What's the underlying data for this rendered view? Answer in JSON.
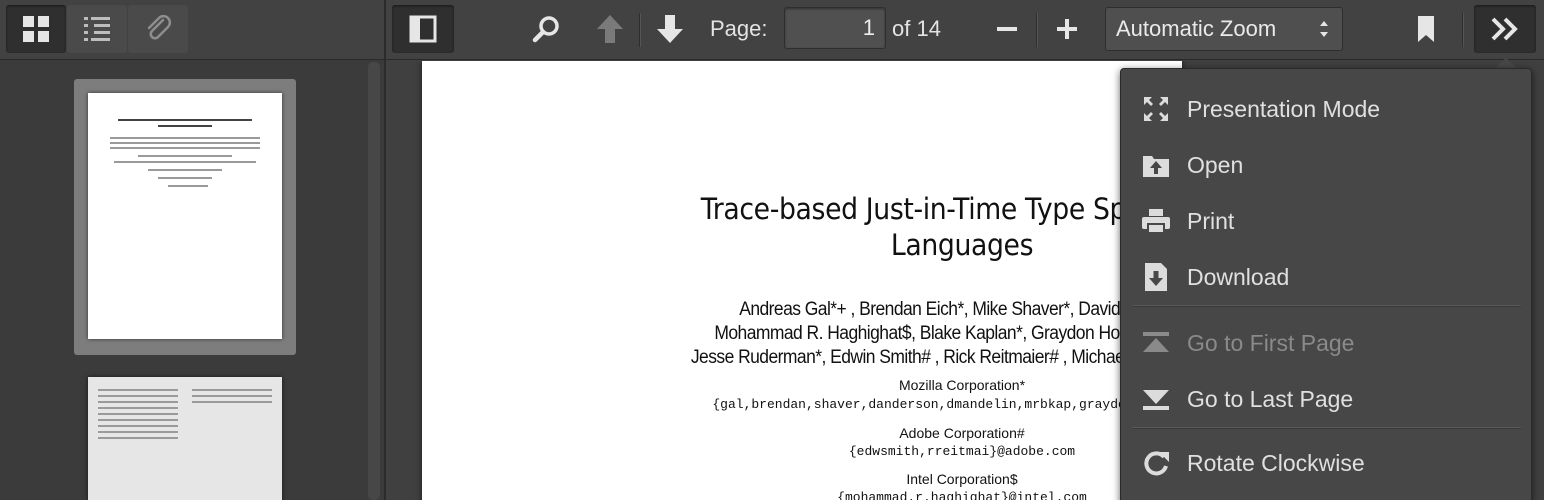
{
  "sidebar": {
    "buttons": [
      {
        "name": "thumbnail-view",
        "icon": "grid-icon"
      },
      {
        "name": "outline-view",
        "icon": "list-icon"
      },
      {
        "name": "attachments-view",
        "icon": "paperclip-icon"
      }
    ]
  },
  "toolbar": {
    "page_label": "Page:",
    "page_value": "1",
    "page_count": "of 14",
    "zoom_value": "Automatic Zoom",
    "icons": [
      "sidebar-toggle-icon",
      "search-icon",
      "previous-page-icon",
      "next-page-icon",
      "zoom-out-icon",
      "zoom-in-icon",
      "bookmark-icon",
      "double-chevron-right-icon"
    ]
  },
  "document": {
    "title_line1": "Trace-based Just-in-Time Type Specializa",
    "title_line2": "Languages",
    "authors_line1": "Andreas Gal*+ , Brendan Eich*, Mike Shaver*, David Anderso",
    "authors_line2": "Mohammad R. Haghighat$, Blake Kaplan*, Graydon Hoare*, Boris Z",
    "authors_line3": "Jesse Ruderman*, Edwin Smith# , Rick Reitmaier# , Michael Bebenita+ , M",
    "org1": "Mozilla Corporation*",
    "email1": "{gal,brendan,shaver,danderson,dmandelin,mrbkap,graydon,bz,jorend",
    "org2": "Adobe Corporation#",
    "email2": "{edwsmith,rreitmai}@adobe.com",
    "org3": "Intel Corporation$",
    "email3": "{mohammad.r.haghighat}@intel.com"
  },
  "menu": {
    "items": [
      {
        "label": "Presentation Mode",
        "icon": "presentation-mode-icon",
        "enabled": true
      },
      {
        "label": "Open",
        "icon": "open-file-icon",
        "enabled": true
      },
      {
        "label": "Print",
        "icon": "print-icon",
        "enabled": true
      },
      {
        "label": "Download",
        "icon": "download-icon",
        "enabled": true
      },
      {
        "label": "Go to First Page",
        "icon": "first-page-icon",
        "enabled": false
      },
      {
        "label": "Go to Last Page",
        "icon": "last-page-icon",
        "enabled": true
      },
      {
        "label": "Rotate Clockwise",
        "icon": "rotate-clockwise-icon",
        "enabled": true
      }
    ]
  },
  "colors": {
    "toolbar": "#424242",
    "sidebar": "#3b3b3b",
    "menu": "#474747",
    "icon": "#e6e6e6",
    "disabled_icon": "#8a8a8a"
  }
}
